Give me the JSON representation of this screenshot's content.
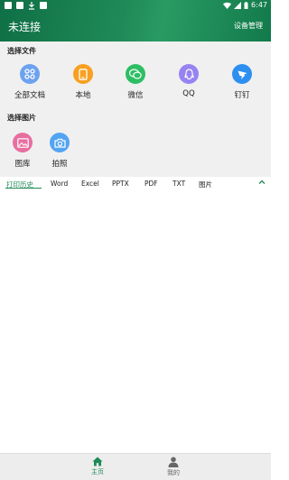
{
  "status_bar": {
    "time": "6:47"
  },
  "header": {
    "title": "未连接",
    "device_management": "设备管理"
  },
  "select_file": {
    "title": "选择文件",
    "items": [
      {
        "label": "全部文档",
        "icon": "grid-icon",
        "color": "#6da2f0"
      },
      {
        "label": "本地",
        "icon": "phone-icon",
        "color": "#f7a021"
      },
      {
        "label": "微信",
        "icon": "wechat-icon",
        "color": "#2dbe63"
      },
      {
        "label": "QQ",
        "icon": "qq-icon",
        "color": "#9783f2"
      },
      {
        "label": "钉钉",
        "icon": "dingtalk-icon",
        "color": "#2d8ff0"
      }
    ]
  },
  "select_image": {
    "title": "选择图片",
    "items": [
      {
        "label": "图库",
        "icon": "gallery-icon",
        "color": "#e86ea0"
      },
      {
        "label": "拍照",
        "icon": "camera-icon",
        "color": "#53a4f2"
      }
    ]
  },
  "tabs": [
    "打印历史",
    "Word",
    "Excel",
    "PPTX",
    "PDF",
    "TXT",
    "图片"
  ],
  "bottom_nav": [
    {
      "label": "主页",
      "icon": "home-icon",
      "active": true
    },
    {
      "label": "我的",
      "icon": "person-icon",
      "active": false
    }
  ],
  "colors": {
    "accent": "#1f8a57",
    "header_bg": "#1a8050"
  }
}
